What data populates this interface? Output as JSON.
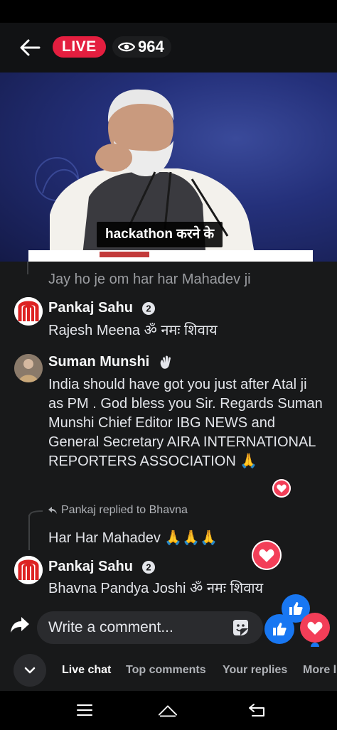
{
  "topbar": {
    "live_label": "LIVE",
    "viewer_count": "964"
  },
  "video": {
    "caption": "hackathon करने के"
  },
  "chat": {
    "faded_comment": "Jay ho je om har har Mahadev ji",
    "comments": [
      {
        "name": "Pankaj Sahu",
        "badge": "verified-badge-icon",
        "text": "Rajesh Meena ॐ नमः शिवाय"
      },
      {
        "name": "Suman Munshi",
        "badge": "wave-hand-icon",
        "text": "India should have got you just after Atal ji as PM . God bless you Sir. Regards Suman Munshi Chief Editor IBG NEWS and General Secretary AIRA INTERNATIONAL REPORTERS ASSOCIATION 🙏"
      },
      {
        "reply_meta": "Pankaj replied to Bhavna",
        "text": "Har Har Mahadev 🙏🙏🙏"
      },
      {
        "name": "Pankaj Sahu",
        "badge": "verified-badge-icon",
        "text": "Bhavna Pandya Joshi ॐ नमः शिवाय"
      }
    ]
  },
  "composer": {
    "placeholder": "Write a comment..."
  },
  "tabs": [
    {
      "label": "Live chat",
      "active": true
    },
    {
      "label": "Top comments",
      "active": false
    },
    {
      "label": "Your replies",
      "active": false
    },
    {
      "label": "More l",
      "active": false
    }
  ],
  "colors": {
    "live_red": "#e41e3f",
    "like_blue": "#1877f2",
    "love_red": "#f33e58",
    "panel_bg": "#18191a"
  }
}
